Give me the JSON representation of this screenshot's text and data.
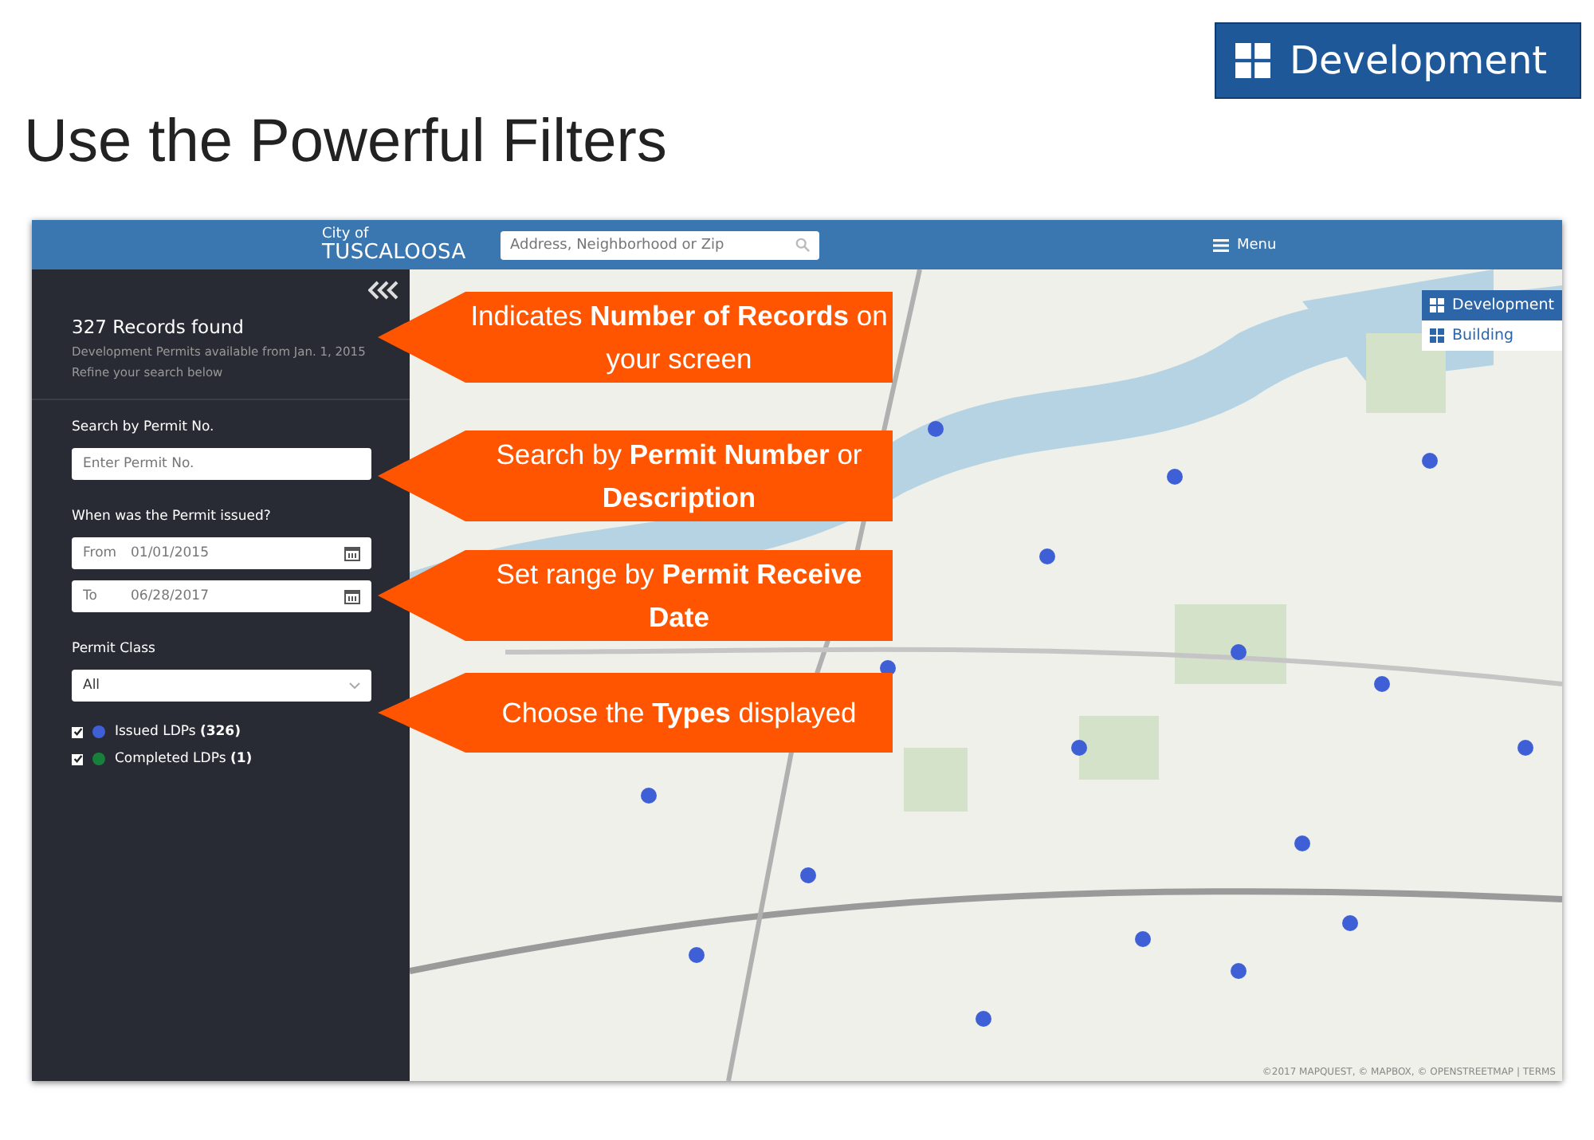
{
  "badge": {
    "label": "Development"
  },
  "title": "Use the Powerful Filters",
  "app": {
    "header": {
      "logo_top": "City of",
      "logo_bottom": "TUSCALOOSA",
      "search_placeholder": "Address, Neighborhood or Zip",
      "menu": "Menu"
    },
    "sidebar": {
      "records": "327 Records found",
      "subtitle": "Development Permits available from Jan. 1, 2015",
      "hint": "Refine your search below",
      "permit_label": "Search by Permit No.",
      "permit_placeholder": "Enter Permit No.",
      "date_label": "When was the Permit issued?",
      "dates": [
        {
          "label": "From",
          "value": "01/01/2015"
        },
        {
          "label": "To",
          "value": "06/28/2017"
        }
      ],
      "class_label": "Permit Class",
      "class_value": "All",
      "legend": [
        {
          "label": "Issued LDPs **(326)**",
          "checked": true,
          "color": "#3f5fd6"
        },
        {
          "label": "Completed LDPs **(1)**",
          "checked": true,
          "color": "#17803a"
        }
      ]
    },
    "layers": [
      {
        "label": "Development",
        "selected": true
      },
      {
        "label": "Building",
        "selected": false
      }
    ],
    "attribution": "©2017 MAPQUEST, © MAPBOX, © OPENSTREETMAP | TERMS"
  },
  "callouts": [
    {
      "text": "Indicates **Number of Records** on your screen"
    },
    {
      "text": "Search by **Permit Number** or **Description**"
    },
    {
      "text": "Set range by **Permit Receive Date**"
    },
    {
      "text": "Choose the **Types** displayed"
    }
  ]
}
